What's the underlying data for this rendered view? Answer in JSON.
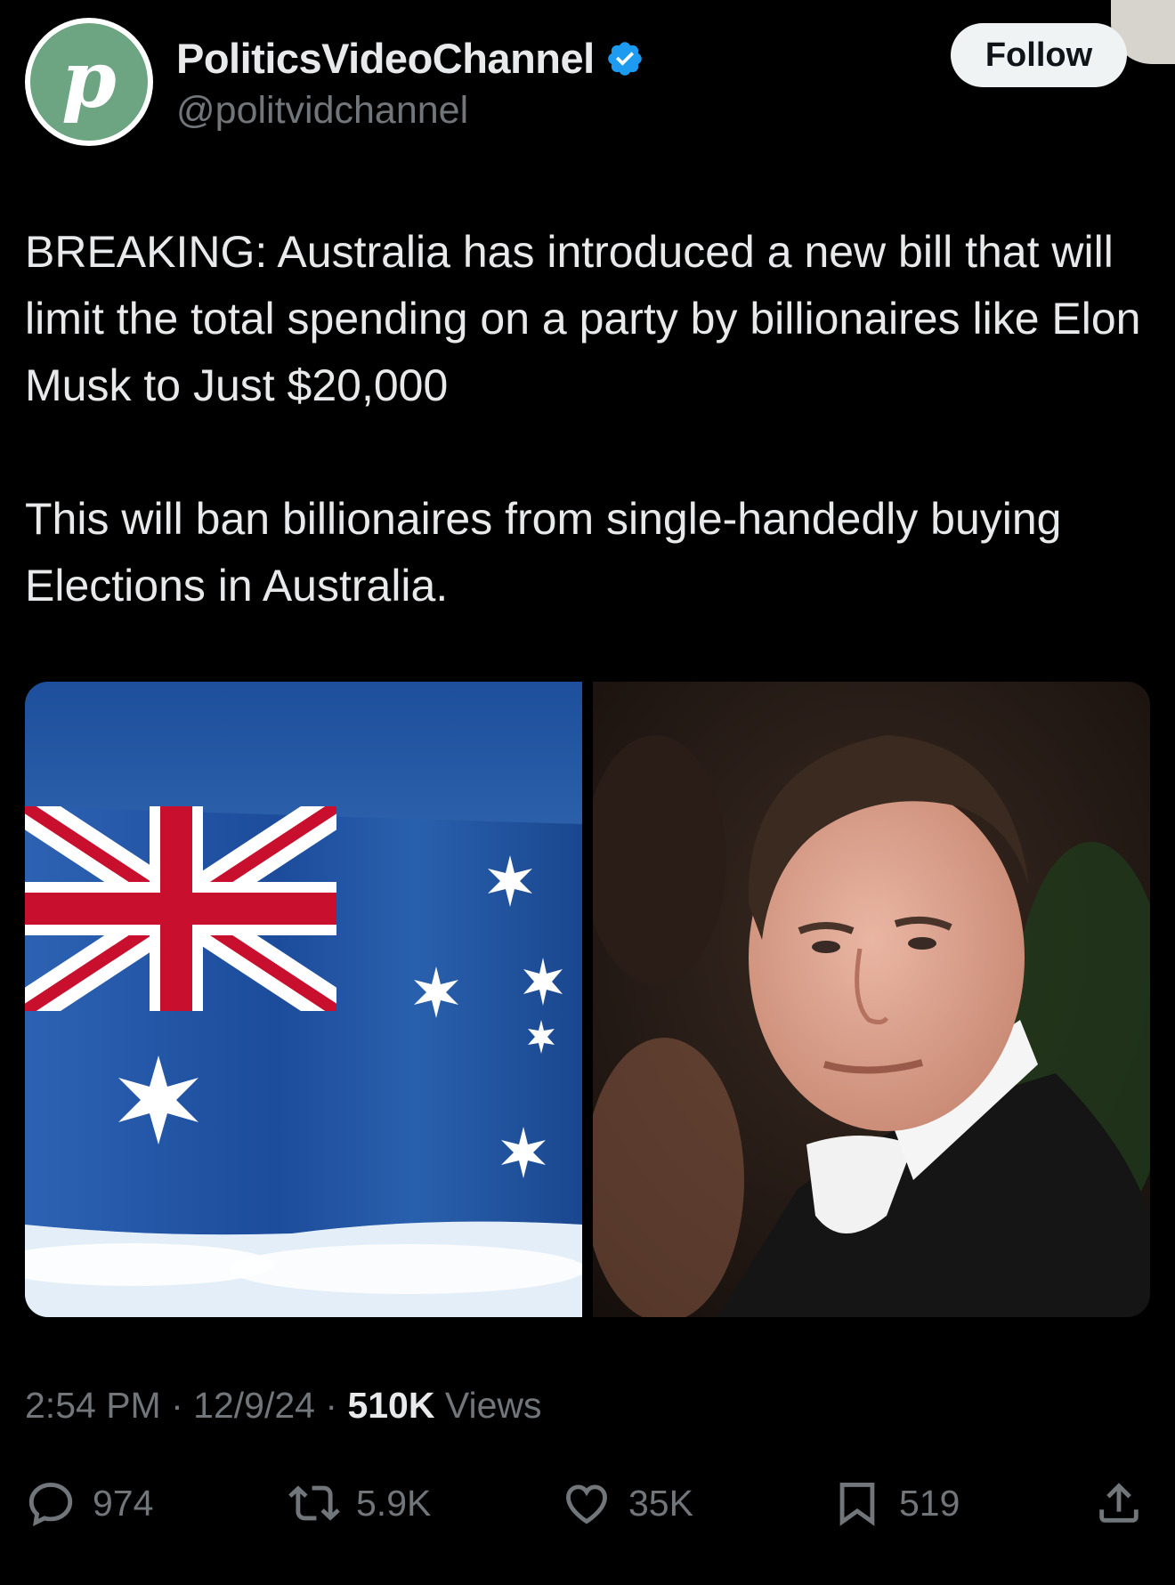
{
  "author": {
    "display_name": "PoliticsVideoChannel",
    "handle": "@politvidchannel",
    "avatar_letter": "p",
    "avatar_color": "#6da482",
    "verified": true,
    "verified_color": "#1d9bf0"
  },
  "follow_label": "Follow",
  "tweet": {
    "paragraphs": [
      "BREAKING: Australia has introduced a new bill that will limit the total spending on a party by billionaires like Elon Musk to Just $20,000",
      "This will ban billionaires from single-handedly buying Elections in Australia."
    ]
  },
  "media": [
    {
      "kind": "australian-flag-photo"
    },
    {
      "kind": "portrait-photo"
    }
  ],
  "meta": {
    "time": "2:54 PM",
    "separator": "·",
    "date": "12/9/24",
    "views_count": "510K",
    "views_label": "Views"
  },
  "actions": {
    "replies": "974",
    "reposts": "5.9K",
    "likes": "35K",
    "bookmarks": "519"
  },
  "colors": {
    "background": "#000000",
    "text": "#e7e9ea",
    "muted": "#71767b",
    "follow_bg": "#eff3f4"
  }
}
